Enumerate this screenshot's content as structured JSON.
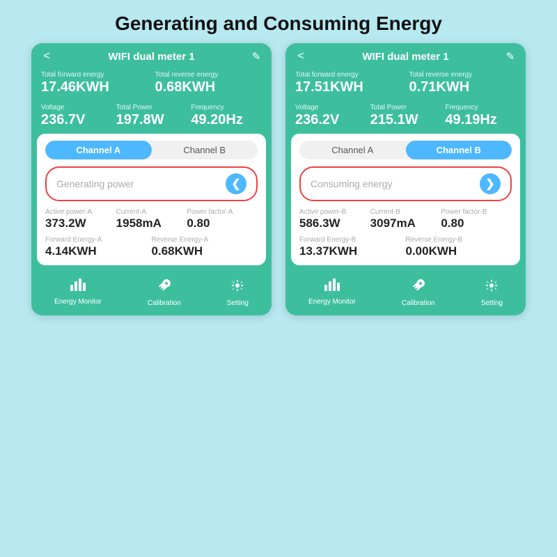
{
  "page": {
    "title": "Generating and Consuming Energy",
    "bg_color": "#b8e8f0"
  },
  "phone_left": {
    "header": {
      "back": "<",
      "title": "WIFI dual meter 1",
      "edit": "✎"
    },
    "total_forward_energy_label": "Total  forward energy",
    "total_forward_energy_value": "17.46KWH",
    "total_reverse_energy_label": "Total reverse energy",
    "total_reverse_energy_value": "0.68KWH",
    "voltage_label": "Voltage",
    "voltage_value": "236.7V",
    "total_power_label": "Total Power",
    "total_power_value": "197.8W",
    "frequency_label": "Frequency",
    "frequency_value": "49.20Hz",
    "tab_a": "Channel A",
    "tab_b": "Channel B",
    "active_tab": "A",
    "mode_text": "Generating power",
    "mode_btn": "❮",
    "active_power_label": "Active power-A",
    "active_power_value": "373.2W",
    "current_label": "Current-A",
    "current_value": "1958mA",
    "power_factor_label": "Power factor-A",
    "power_factor_value": "0.80",
    "forward_energy_label": "Forward Energy-A",
    "forward_energy_value": "4.14KWH",
    "reverse_energy_label": "Reverse Energy-A",
    "reverse_energy_value": "0.68KWH",
    "nav": [
      {
        "label": "Energy Monitor",
        "icon": "chart"
      },
      {
        "label": "Calibration",
        "icon": "wrench"
      },
      {
        "label": "Setting",
        "icon": "gear"
      }
    ]
  },
  "phone_right": {
    "header": {
      "back": "<",
      "title": "WIFI dual meter 1",
      "edit": "✎"
    },
    "total_forward_energy_label": "Total  forward energy",
    "total_forward_energy_value": "17.51KWH",
    "total_reverse_energy_label": "Total reverse energy",
    "total_reverse_energy_value": "0.71KWH",
    "voltage_label": "Voltage",
    "voltage_value": "236.2V",
    "total_power_label": "Total Power",
    "total_power_value": "215.1W",
    "frequency_label": "Frequency",
    "frequency_value": "49.19Hz",
    "tab_a": "Channel A",
    "tab_b": "Channel B",
    "active_tab": "B",
    "mode_text": "Consuming energy",
    "mode_btn": "❯",
    "active_power_label": "Active power-B",
    "active_power_value": "586.3W",
    "current_label": "Current-B",
    "current_value": "3097mA",
    "power_factor_label": "Power factor-B",
    "power_factor_value": "0.80",
    "forward_energy_label": "Forward Energy-B",
    "forward_energy_value": "13.37KWH",
    "reverse_energy_label": "Reverse Energy-B",
    "reverse_energy_value": "0.00KWH",
    "nav": [
      {
        "label": "Energy Monitor",
        "icon": "chart"
      },
      {
        "label": "Calibration",
        "icon": "wrench"
      },
      {
        "label": "Setting",
        "icon": "gear"
      }
    ]
  }
}
